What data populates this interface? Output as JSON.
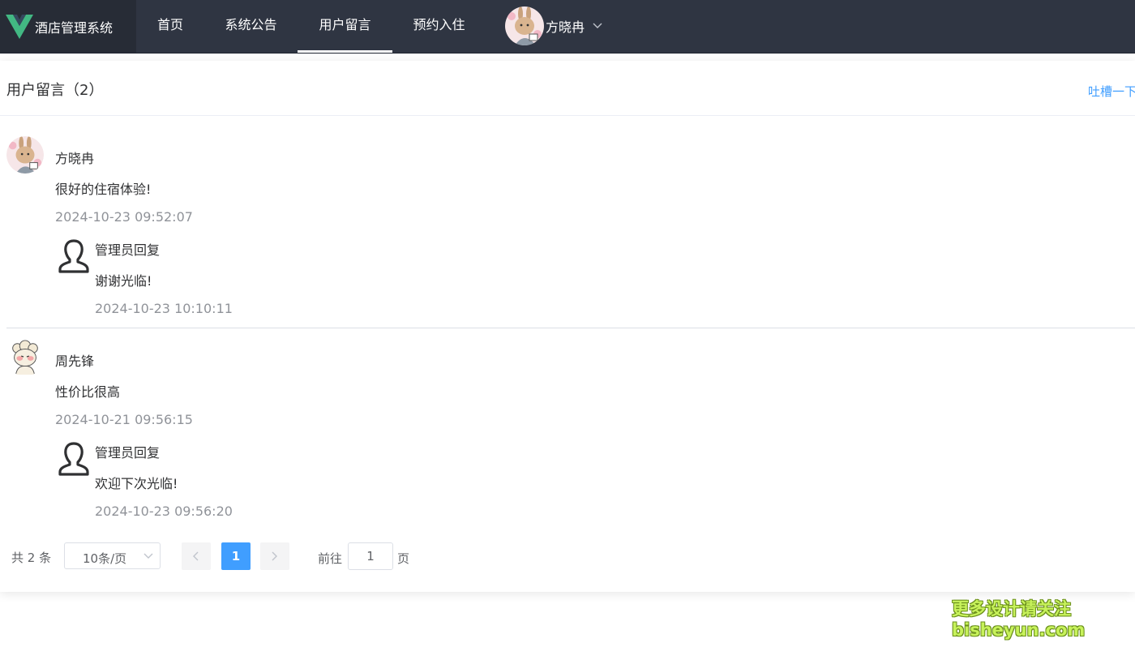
{
  "header": {
    "brand_name": "酒店管理系统",
    "nav": [
      {
        "label": "首页",
        "active": false
      },
      {
        "label": "系统公告",
        "active": false
      },
      {
        "label": "用户留言",
        "active": true
      },
      {
        "label": "预约入住",
        "active": false
      }
    ],
    "user_name": "方晓冉",
    "colors": {
      "bar": "#2f3542",
      "brand_bg": "#272c36",
      "logo": "#42b883"
    }
  },
  "panel": {
    "title": "用户留言（2）",
    "complain_link": "吐槽一下"
  },
  "comments": [
    {
      "name": "方晓冉",
      "text": "很好的住宿体验!",
      "time": "2024-10-23 09:52:07",
      "avatar": "bunny-avatar",
      "reply": {
        "name": "管理员回复",
        "text": "谢谢光临!",
        "time": "2024-10-23 10:10:11"
      }
    },
    {
      "name": "周先锋",
      "text": "性价比很高",
      "time": "2024-10-21 09:56:15",
      "avatar": "sheep-avatar",
      "reply": {
        "name": "管理员回复",
        "text": "欢迎下次光临!",
        "time": "2024-10-23 09:56:20"
      }
    }
  ],
  "pagination": {
    "total": "共 2 条",
    "page_size": "10条/页",
    "current_page": "1",
    "goto_label": "前往",
    "goto_value": "1",
    "goto_suffix": "页"
  },
  "watermark": {
    "line1": "更多设计请关注",
    "line2": "bisheyun.com"
  }
}
